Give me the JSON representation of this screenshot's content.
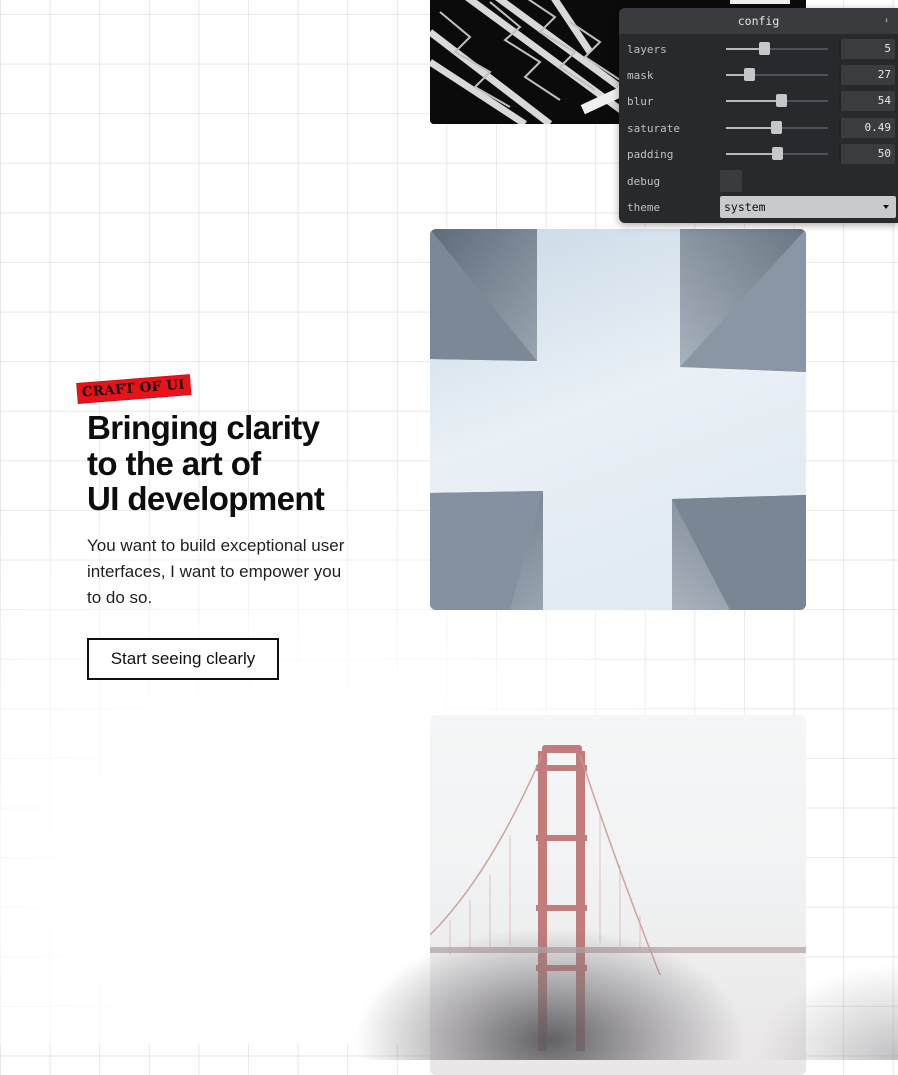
{
  "hero": {
    "tag": "CRAFT OF UI",
    "headline_lines": [
      "Bringing clarity",
      "to the art of",
      "UI development"
    ],
    "subtext": "You want to build exceptional user interfaces, I want to empower you to do so.",
    "cta_label": "Start seeing clearly"
  },
  "config": {
    "title": "config",
    "collapse_icon": "collapse-icon",
    "rows": [
      {
        "label": "layers",
        "value": "5",
        "level": 0.37
      },
      {
        "label": "mask",
        "value": "27",
        "level": 0.23
      },
      {
        "label": "blur",
        "value": "54",
        "level": 0.54
      },
      {
        "label": "saturate",
        "value": "0.49",
        "level": 0.49
      },
      {
        "label": "padding",
        "value": "50",
        "level": 0.5
      }
    ],
    "debug": {
      "label": "debug",
      "checked": false
    },
    "theme": {
      "label": "theme",
      "value": "system"
    }
  },
  "colors": {
    "tag_bg": "#e8121b",
    "panel_bg": "#28292c",
    "text": "#0d0d0d"
  }
}
